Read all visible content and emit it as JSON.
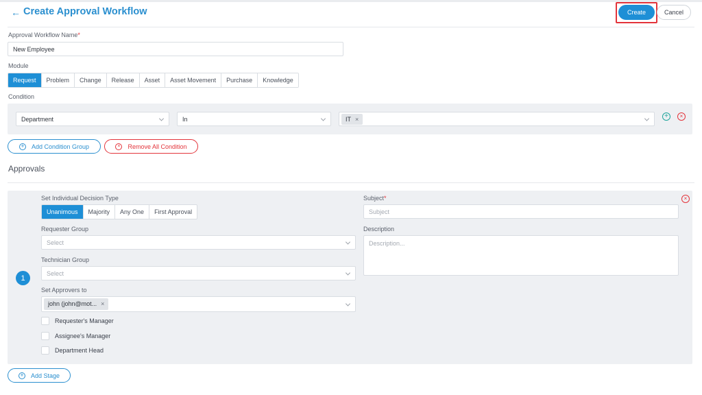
{
  "header": {
    "back_icon": "arrow-left-icon",
    "title": "Create Approval Workflow",
    "create_label": "Create",
    "cancel_label": "Cancel"
  },
  "form": {
    "name_label": "Approval Workflow Name",
    "name_value": "New Employee",
    "module_label": "Module",
    "modules": [
      "Request",
      "Problem",
      "Change",
      "Release",
      "Asset",
      "Asset Movement",
      "Purchase",
      "Knowledge"
    ],
    "active_module": "Request",
    "condition_label": "Condition",
    "condition": {
      "field": "Department",
      "operator": "In",
      "value_chip": "IT"
    },
    "add_condition_group_label": "Add Condition Group",
    "remove_all_condition_label": "Remove All Condition"
  },
  "approvals": {
    "section_title": "Approvals",
    "stage_number": "1",
    "decision_type_label": "Set Individual Decision Type",
    "decision_types": [
      "Unanimous",
      "Majority",
      "Any One",
      "First Approval"
    ],
    "active_decision_type": "Unanimous",
    "requester_group_label": "Requester Group",
    "requester_group_placeholder": "Select",
    "technician_group_label": "Technician Group",
    "technician_group_placeholder": "Select",
    "set_approvers_label": "Set Approvers to",
    "approver_chip": "john (john@mot...",
    "checkboxes": [
      "Requester's Manager",
      "Assignee's Manager",
      "Department Head"
    ],
    "subject_label": "Subject",
    "subject_placeholder": "Subject",
    "description_label": "Description",
    "description_placeholder": "Description...",
    "add_stage_label": "Add Stage"
  },
  "colors": {
    "accent": "#1e8fd6",
    "title": "#2a8fcf",
    "danger": "#e3333a",
    "success": "#1fa59c",
    "panel_bg": "#eef0f3"
  }
}
